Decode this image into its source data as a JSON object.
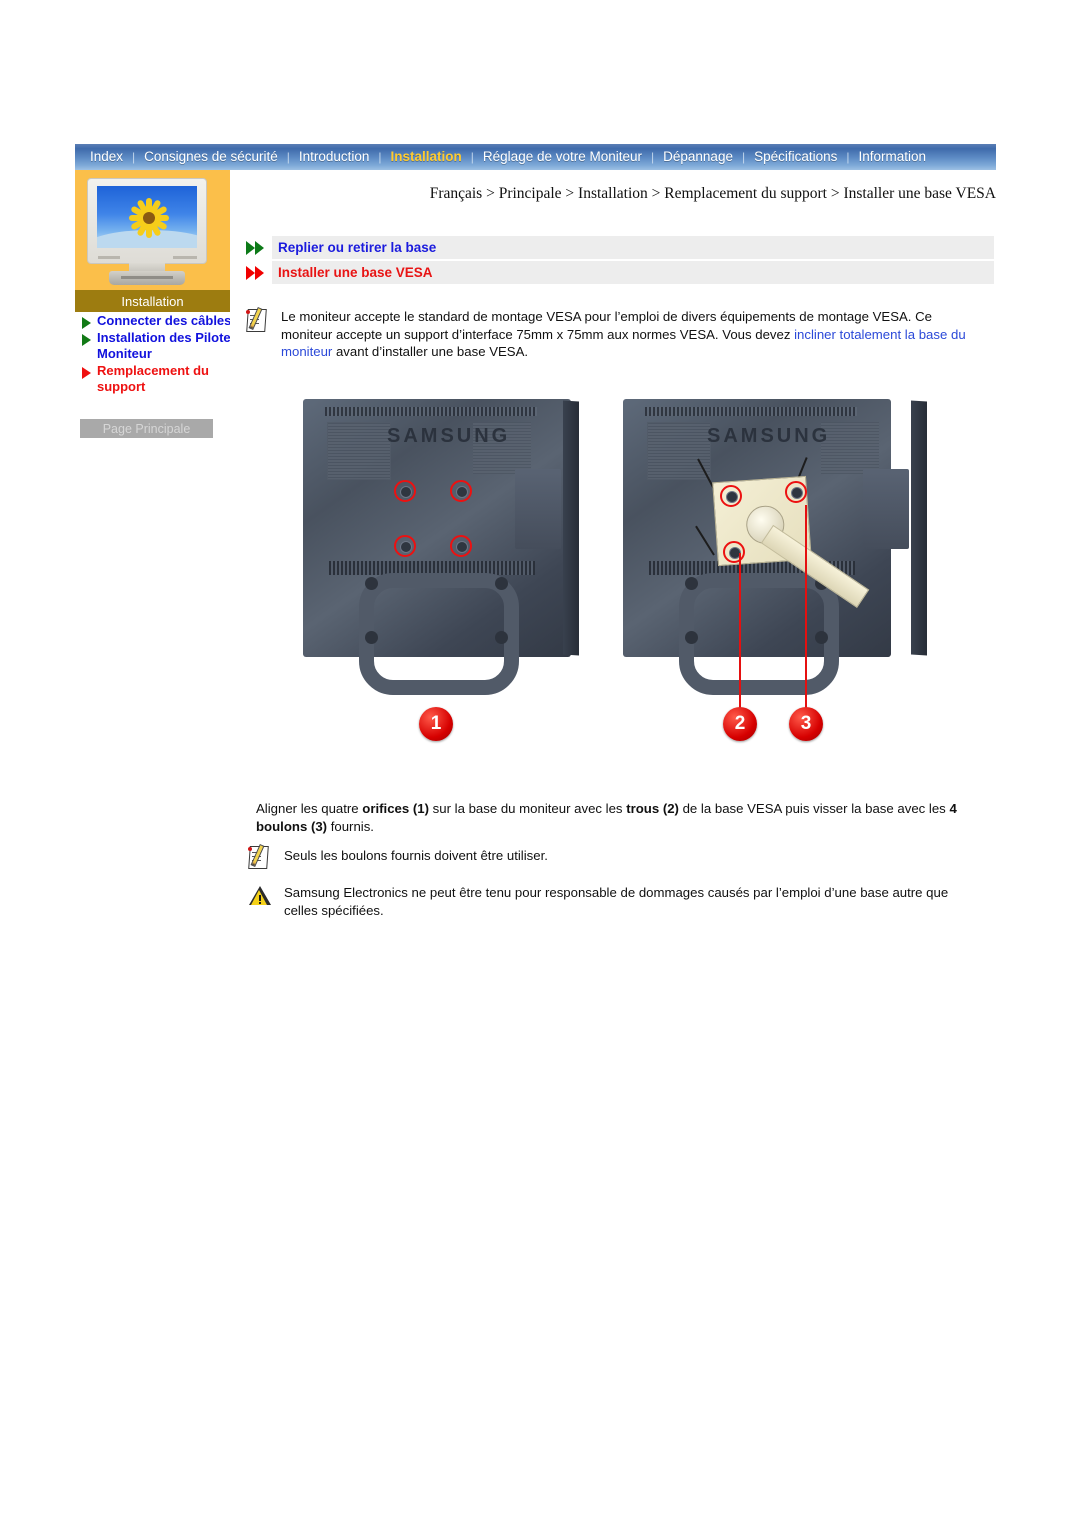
{
  "nav": {
    "items": [
      {
        "label": "Index",
        "active": false
      },
      {
        "label": "Consignes de sécurité",
        "active": false
      },
      {
        "label": "Introduction",
        "active": false
      },
      {
        "label": "Installation",
        "active": true
      },
      {
        "label": "Réglage de votre Moniteur",
        "active": false
      },
      {
        "label": "Dépannage",
        "active": false
      },
      {
        "label": "Spécifications",
        "active": false
      },
      {
        "label": "Information",
        "active": false
      }
    ],
    "separator": "|"
  },
  "sidebar": {
    "section_title": "Installation",
    "thumbnail_alt": "monitor-sunflower-thumbnail",
    "items": [
      {
        "label": "Connecter des câbles",
        "color": "blue",
        "marker": "green"
      },
      {
        "label": "Installation des Pilotes Moniteur",
        "color": "blue",
        "marker": "green"
      },
      {
        "label": "Remplacement du support",
        "color": "red",
        "marker": "red"
      }
    ],
    "home_button": "Page Principale"
  },
  "breadcrumb": "Français > Principale > Installation > Remplacement du support > Installer une base VESA",
  "links": [
    {
      "label": "Replier ou retirer la base",
      "color": "blue",
      "marker": "green"
    },
    {
      "label": "Installer une base VESA",
      "color": "red",
      "marker": "red"
    }
  ],
  "intro": {
    "part1": "Le moniteur accepte le standard de montage VESA pour l’emploi de divers équipements de montage VESA. Ce moniteur accepte un support d’interface 75mm x 75mm aux normes VESA. Vous devez ",
    "link": "incliner totalement la base du moniteur",
    "part2": " avant d’installer une base VESA."
  },
  "figures": [
    {
      "badges": [
        "1"
      ],
      "brand": "SAMSUNG",
      "holes": 4
    },
    {
      "badges": [
        "2",
        "3"
      ],
      "brand": "SAMSUNG",
      "holes": 3
    }
  ],
  "instruction": {
    "s1": "Aligner les quatre ",
    "b1": "orifices (1)",
    "s2": " sur la base du moniteur avec les ",
    "b2": "trous (2)",
    "s3": " de la base VESA puis visser la base avec les ",
    "b3": "4 boulons (3)",
    "s4": " fournis."
  },
  "note": "Seuls les boulons fournis doivent être utiliser.",
  "warning": "Samsung Electronics ne peut être tenu pour responsable de dommages causés par l’emploi d’une base autre que celles spécifiées.",
  "colors": {
    "nav_blue": "#4b77b4",
    "nav_active": "#ffcb2f",
    "panel_orange": "#fbbf4a",
    "section_gold": "#9d7c10",
    "link_blue": "#1b1bdd",
    "link_red": "#e81414",
    "badge_red": "#d60000",
    "warn_yellow": "#f5d118"
  }
}
